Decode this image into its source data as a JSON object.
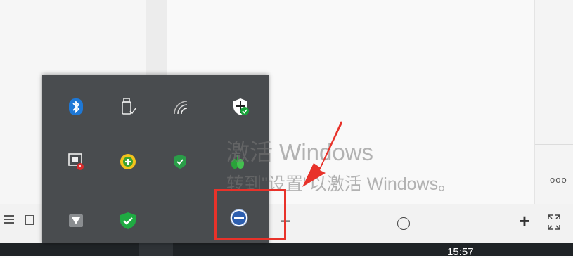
{
  "watermark": {
    "line1": "激活 Windows",
    "line2": "转到\"设置\"以激活 Windows。"
  },
  "status_bar": {
    "zoom_minus": "−",
    "zoom_plus": "+",
    "zoom_level_fraction": 0.46
  },
  "taskbar": {
    "clock": "15:57"
  },
  "right_panel": {
    "more": "ooo"
  },
  "tray": {
    "icons": [
      {
        "name": "bluetooth-icon"
      },
      {
        "name": "usb-drive-icon"
      },
      {
        "name": "wifi-icon"
      },
      {
        "name": "windows-security-icon"
      },
      {
        "name": "screen-record-icon"
      },
      {
        "name": "security-plus-icon"
      },
      {
        "name": "shield-check-icon"
      },
      {
        "name": "green-bird-icon"
      },
      {
        "name": "message-app-icon"
      },
      {
        "name": "check-shield-icon"
      },
      {
        "name": "selected-tray-app-icon"
      }
    ]
  },
  "colors": {
    "highlight": "#e8322a",
    "tray_background": "#494c4f",
    "taskbar": "#1f2326"
  }
}
